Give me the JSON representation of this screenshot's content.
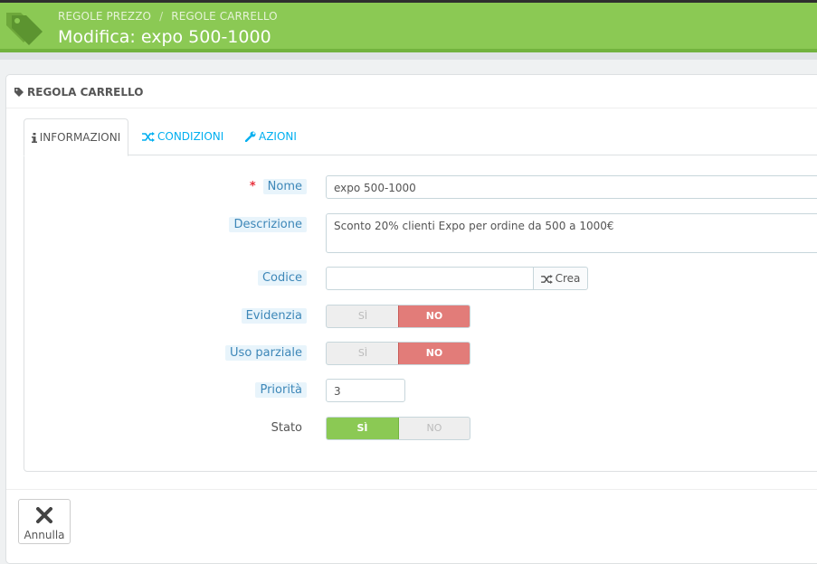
{
  "header": {
    "breadcrumb": [
      "REGOLE PREZZO",
      "REGOLE CARRELLO"
    ],
    "breadcrumb_sep": "/",
    "title": "Modifica: expo 500-1000",
    "icon": "tags-icon"
  },
  "panel": {
    "heading": "REGOLA CARRELLO",
    "heading_icon": "tag-icon"
  },
  "tabs": [
    {
      "label": "INFORMAZIONI",
      "icon": "info-icon",
      "active": true
    },
    {
      "label": "CONDIZIONI",
      "icon": "random-icon",
      "active": false
    },
    {
      "label": "AZIONI",
      "icon": "wrench-icon",
      "active": false
    }
  ],
  "form": {
    "required_mark": "*",
    "name": {
      "label": "Nome",
      "value": "expo 500-1000"
    },
    "description": {
      "label": "Descrizione",
      "value": "Sconto 20% clienti Expo per ordine da 500 a 1000€"
    },
    "code": {
      "label": "Codice",
      "value": "",
      "button": "Crea"
    },
    "highlight": {
      "label": "Evidenzia",
      "yes": "SÌ",
      "no": "NO",
      "selected": "NO"
    },
    "partial_use": {
      "label": "Uso parziale",
      "yes": "SÌ",
      "no": "NO",
      "selected": "NO"
    },
    "priority": {
      "label": "Priorità",
      "value": "3"
    },
    "status": {
      "label": "Stato",
      "yes": "SÌ",
      "no": "NO",
      "selected": "SÌ"
    }
  },
  "footer": {
    "cancel_label": "Annulla"
  },
  "colors": {
    "header_green": "#8bc954",
    "no_red": "#e27c79",
    "yes_green": "#8bc954",
    "link_blue": "#00aff0"
  }
}
